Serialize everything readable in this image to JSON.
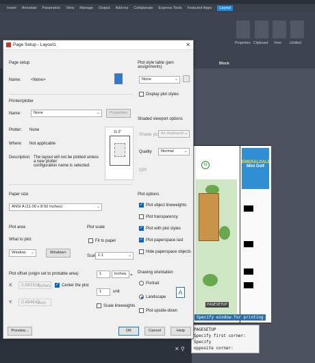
{
  "app": {
    "ribbon_tabs": [
      "Insert",
      "Annotate",
      "Parametric",
      "View",
      "Manage",
      "Output",
      "Add-ins",
      "Collaborate",
      "Express Tools",
      "Featured Apps",
      "Layout"
    ],
    "ribbon_labels": [
      "Properties",
      "Clipboard",
      "View",
      "Untitled"
    ],
    "block_label": "Block",
    "logo_line1": "EMERALDALE",
    "logo_line2": "Mini Golf",
    "tooltip_point": "PAGESETUP",
    "tooltip_cmd": "Specify window for printing",
    "cmdline": [
      "PAGESETUP",
      "Specify first corner: Specify",
      "opposite corner:"
    ],
    "accent": "#1f87d6"
  },
  "dialog": {
    "title": "Page Setup - Layout1",
    "page_setup": {
      "section": "Page setup",
      "name_label": "Name:",
      "name_value": "<None>"
    },
    "printer": {
      "section": "Printer/plotter",
      "name_label": "Name:",
      "name_value": "None",
      "properties_button": "Properties",
      "plotter_label": "Plotter:",
      "plotter_value": "None",
      "where_label": "Where:",
      "where_value": "Not applicable",
      "desc_label": "Description:",
      "desc_value_1": "The layout will not be plotted unless a new plotter",
      "desc_value_2": "configuration name is selected.",
      "preview_width": "11.0\""
    },
    "paper_size": {
      "section": "Paper size",
      "value": "ANSI A (11.00 x 8.50 Inches)"
    },
    "plot_area": {
      "section": "Plot area",
      "what_label": "What to plot:",
      "what_value": "Window",
      "window_button": "Window<"
    },
    "plot_offset": {
      "section": "Plot offset (origin set to printable area)",
      "x_label": "X:",
      "x_value": "2.083316",
      "x_unit": "inches",
      "y_label": "Y:",
      "y_value": "0.494642",
      "y_unit": "inch",
      "center_label": "Center the plot"
    },
    "plot_scale": {
      "section": "Plot scale",
      "fit_label": "Fit to paper",
      "scale_label": "Scale:",
      "scale_value": "1:1",
      "value1": "1",
      "unit1": "inches",
      "value2": "1",
      "unit2": "unit",
      "lineweights_label": "Scale lineweights"
    },
    "plot_style": {
      "section": "Plot style table (pen assignments)",
      "value": "None",
      "display_label": "Display plot styles"
    },
    "shaded": {
      "section": "Shaded viewport options",
      "shade_label": "Shade plot",
      "shade_value": "As displayed",
      "quality_label": "Quality",
      "quality_value": "Normal",
      "dpi_label": "DPI"
    },
    "plot_options": {
      "section": "Plot options",
      "items": [
        {
          "label": "Plot object lineweights",
          "checked": true
        },
        {
          "label": "Plot transparency",
          "checked": false
        },
        {
          "label": "Plot with plot styles",
          "checked": true
        },
        {
          "label": "Plot paperspace last",
          "checked": true
        },
        {
          "label": "Hide paperspace objects",
          "checked": false
        }
      ]
    },
    "orientation": {
      "section": "Drawing orientation",
      "portrait": "Portrait",
      "landscape": "Landscape",
      "upside": "Plot upside-down"
    },
    "buttons": {
      "preview": "Preview...",
      "ok": "OK",
      "cancel": "Cancel",
      "help": "Help"
    }
  }
}
